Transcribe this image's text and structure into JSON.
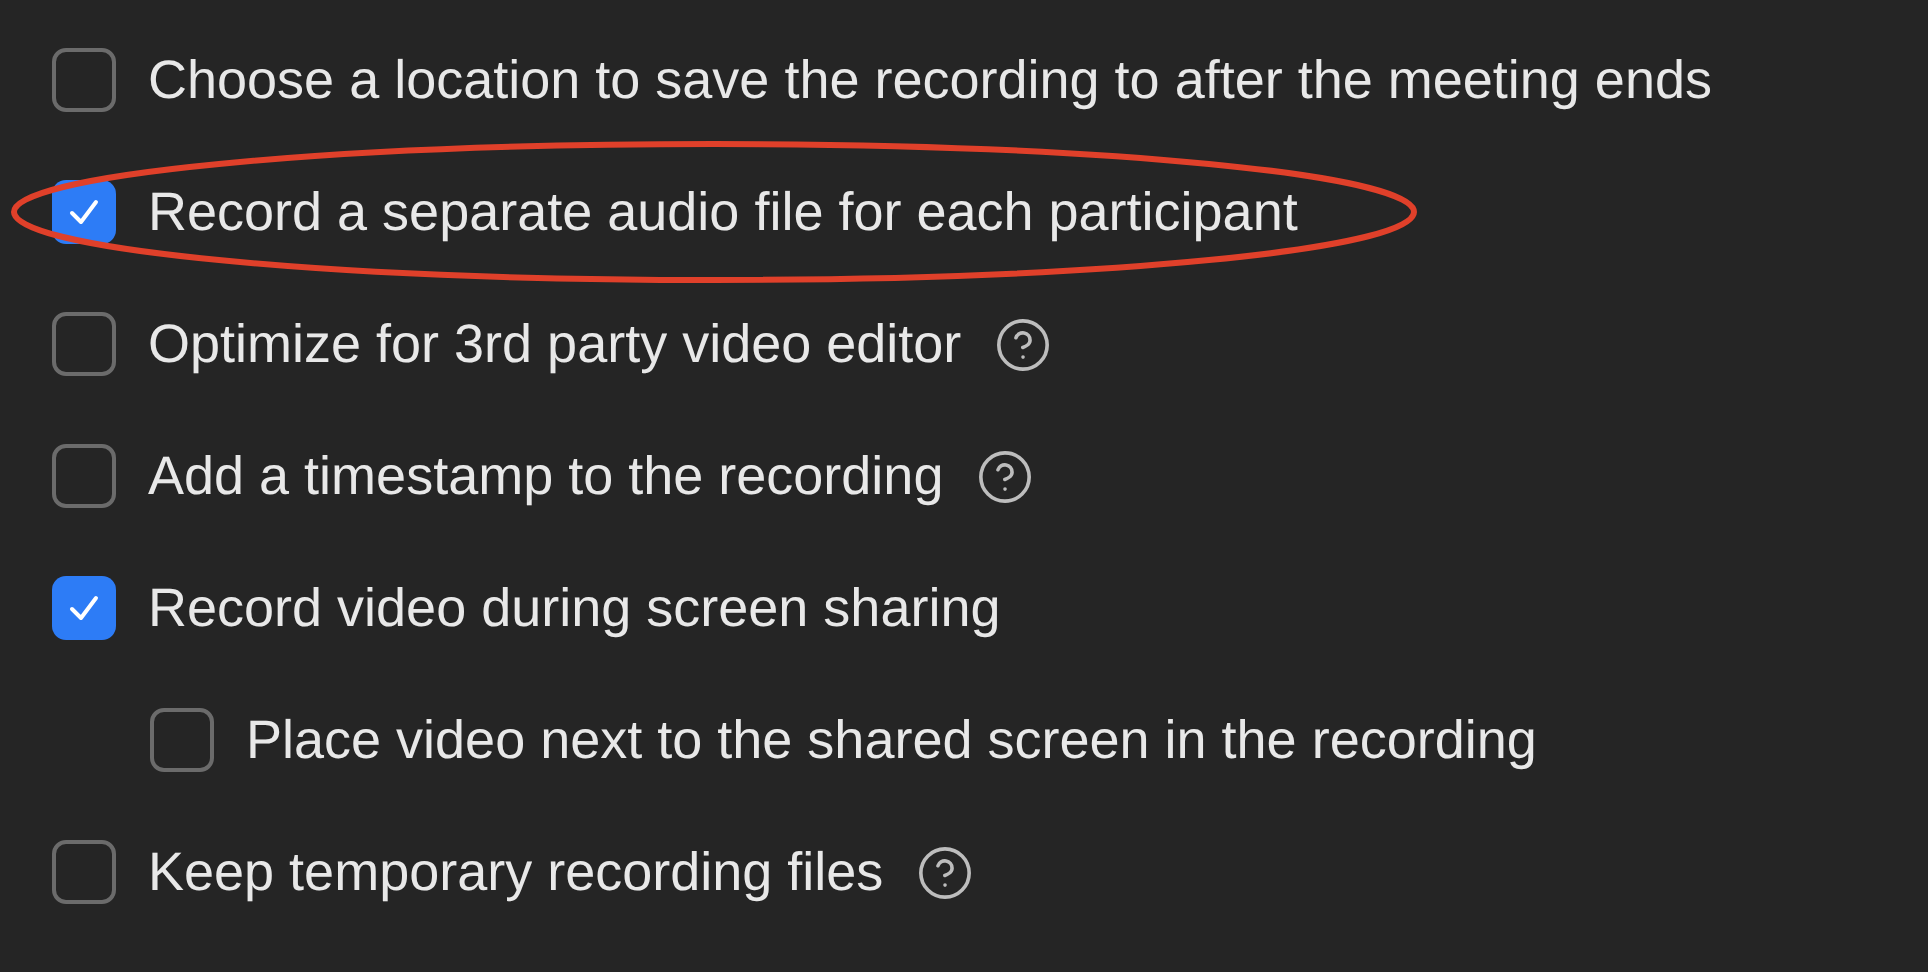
{
  "options": [
    {
      "label": "Choose a location to save the recording to after the meeting ends",
      "checked": false,
      "help": false
    },
    {
      "label": "Record a separate audio file for each participant",
      "checked": true,
      "help": false
    },
    {
      "label": "Optimize for 3rd party video editor",
      "checked": false,
      "help": true
    },
    {
      "label": "Add a timestamp to the recording",
      "checked": false,
      "help": true
    },
    {
      "label": "Record video during screen sharing",
      "checked": true,
      "help": false,
      "children": [
        {
          "label": "Place video next to the shared screen in the recording",
          "checked": false,
          "help": false
        }
      ]
    },
    {
      "label": "Keep temporary recording files",
      "checked": false,
      "help": true
    }
  ]
}
